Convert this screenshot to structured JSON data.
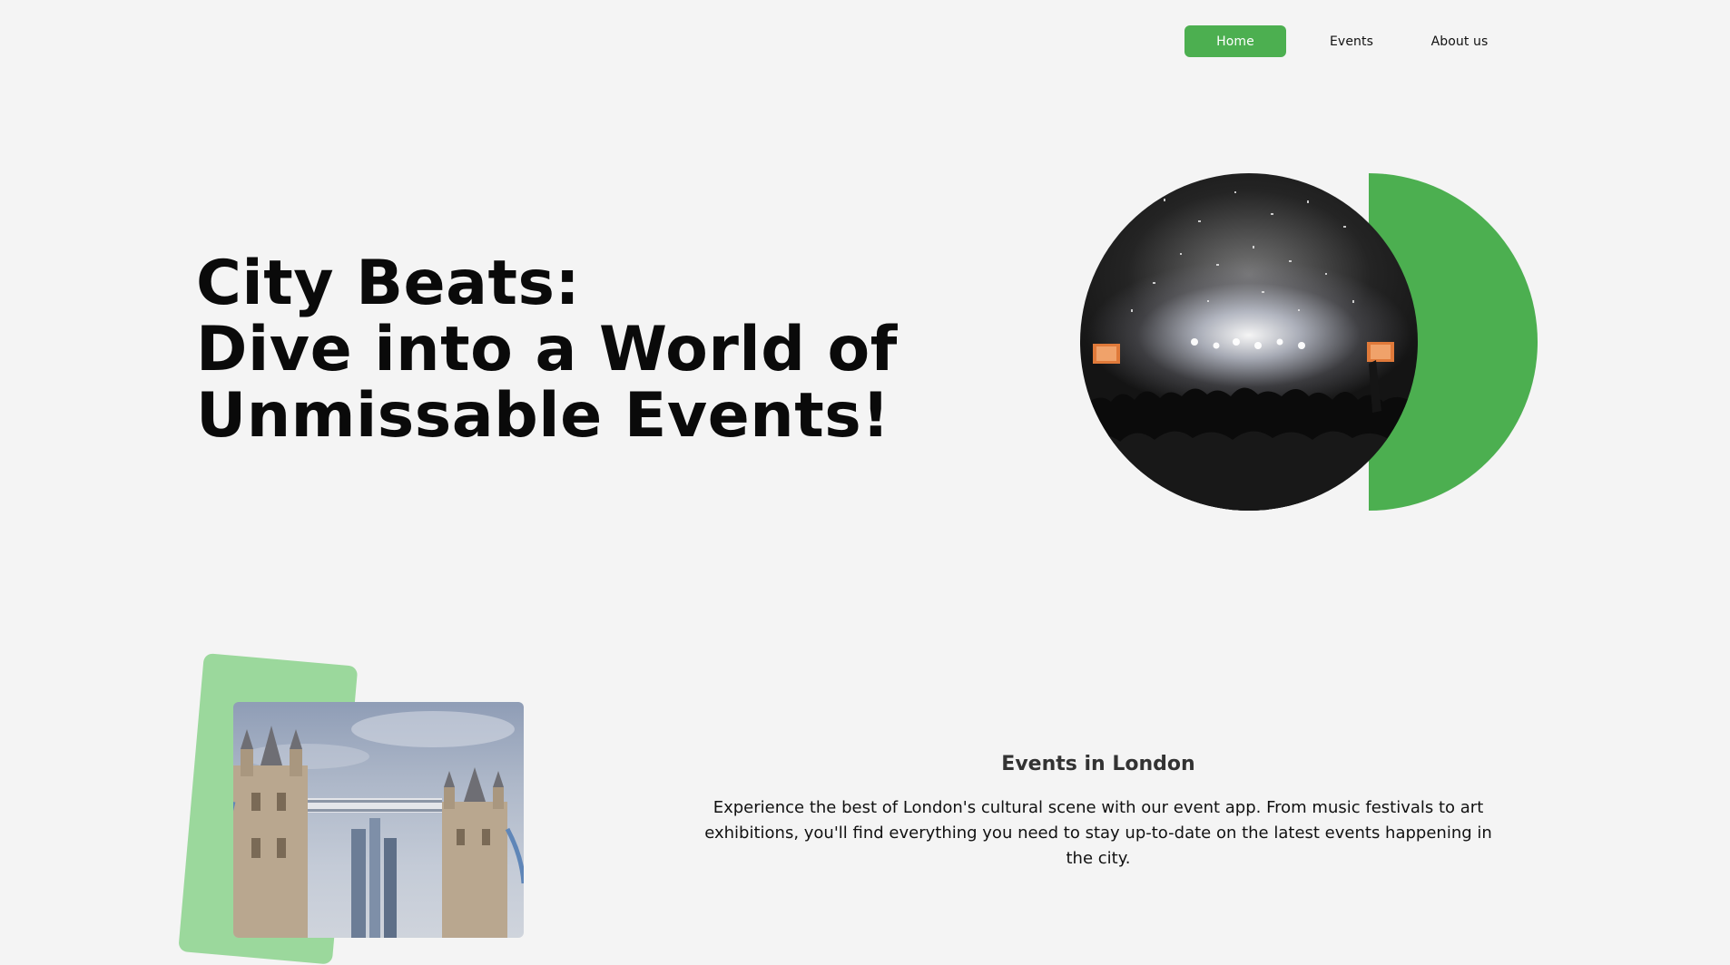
{
  "nav": {
    "home_label": "Home",
    "events_label": "Events",
    "about_label": "About us",
    "active": "Home"
  },
  "hero": {
    "title_line1": "City Beats:",
    "title_line2": "Dive into a World of",
    "title_line3": "Unmissable Events!",
    "image": "concert-crowd-photo"
  },
  "intro": {
    "image": "tower-bridge-photo",
    "heading": "Events in London",
    "body": "Experience the best of London's cultural scene with our event app. From music festivals to art exhibitions, you'll find everything you need to stay up-to-date on the latest events happening in the city."
  },
  "colors": {
    "background": "#f4f4f4",
    "accent": "#4caf50",
    "accent_light": "#9bd89c",
    "text": "#0a0a0a"
  }
}
